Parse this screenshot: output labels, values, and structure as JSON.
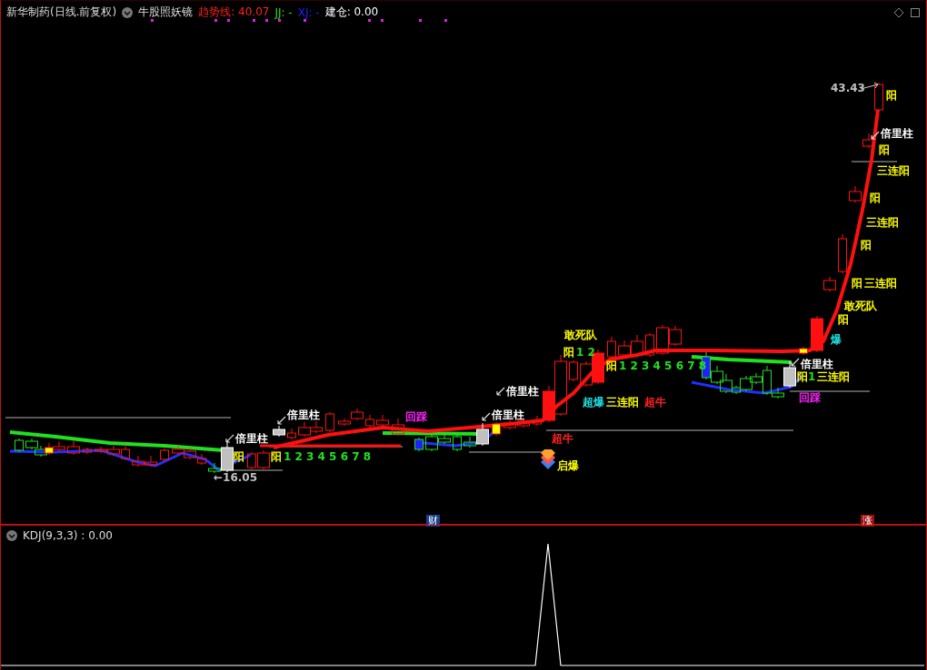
{
  "header": {
    "title": "新华制药(日线.前复权)",
    "indicator": "牛股照妖镜",
    "readings": [
      {
        "label": "趋势线: 40.07",
        "color": "#ff2020"
      },
      {
        "label": "JJ: -",
        "color": "#20e020"
      },
      {
        "label": "XJ: -",
        "color": "#2020ff"
      },
      {
        "label": "建仓: 0.00",
        "color": "#ffffff"
      }
    ]
  },
  "annotations": [
    {
      "text": "43.43",
      "color": "#c0c0c0"
    },
    {
      "text": "阳",
      "color": "#ffff00"
    },
    {
      "text": "倍里柱",
      "color": "#ffffff"
    },
    {
      "text": "阳",
      "color": "#ffff00"
    },
    {
      "text": "三连阳",
      "color": "#ffff00"
    },
    {
      "text": "阳",
      "color": "#ffff00"
    },
    {
      "text": "三连阳",
      "color": "#ffff00"
    },
    {
      "text": "阳",
      "color": "#ffff00"
    },
    {
      "text": "阳",
      "color": "#ffff00"
    },
    {
      "text": "三连阳",
      "color": "#ffff00"
    },
    {
      "text": "敢死队",
      "color": "#ffff00"
    },
    {
      "text": "阳",
      "color": "#ffff00"
    },
    {
      "text": "敢死队",
      "color": "#ffff00"
    },
    {
      "text": "爆",
      "color": "#20e0e0"
    },
    {
      "text": "阳",
      "color": "#ffff00"
    },
    {
      "text": "1 2",
      "color": "#20e020"
    },
    {
      "text": "阳",
      "color": "#ffff00"
    },
    {
      "text": "1 2 3 4 5 6 7 8",
      "color": "#20e020"
    },
    {
      "text": "倍里柱",
      "color": "#ffffff"
    },
    {
      "text": "阳",
      "color": "#ffff00"
    },
    {
      "text": "1",
      "color": "#20e020"
    },
    {
      "text": "三连阳",
      "color": "#ffff00"
    },
    {
      "text": "倍里柱",
      "color": "#ffffff"
    },
    {
      "text": "超爆",
      "color": "#20e0e0"
    },
    {
      "text": "三连阳",
      "color": "#ffff00"
    },
    {
      "text": "超牛",
      "color": "#ff2020"
    },
    {
      "text": "回踩",
      "color": "#ff20ff"
    },
    {
      "text": "倍里柱",
      "color": "#ffffff"
    },
    {
      "text": "回踩",
      "color": "#ff20ff"
    },
    {
      "text": "倍里柱",
      "color": "#ffffff"
    },
    {
      "text": "倍里柱",
      "color": "#ffffff"
    },
    {
      "text": "超牛",
      "color": "#ff2020"
    },
    {
      "text": "阳",
      "color": "#ffff00"
    },
    {
      "text": "阳",
      "color": "#ffff00"
    },
    {
      "text": "1 2 3 4 5 6 7 8",
      "color": "#20e020"
    },
    {
      "text": "启爆",
      "color": "#ffff00"
    },
    {
      "text": "←16.05",
      "color": "#c0c0c0"
    }
  ],
  "badges": [
    {
      "text": "财",
      "color": "#1a3f8f"
    },
    {
      "text": "涨",
      "color": "#a01010"
    }
  ],
  "kdj": {
    "label": "KDJ(9,3,3) : 0.00"
  }
}
